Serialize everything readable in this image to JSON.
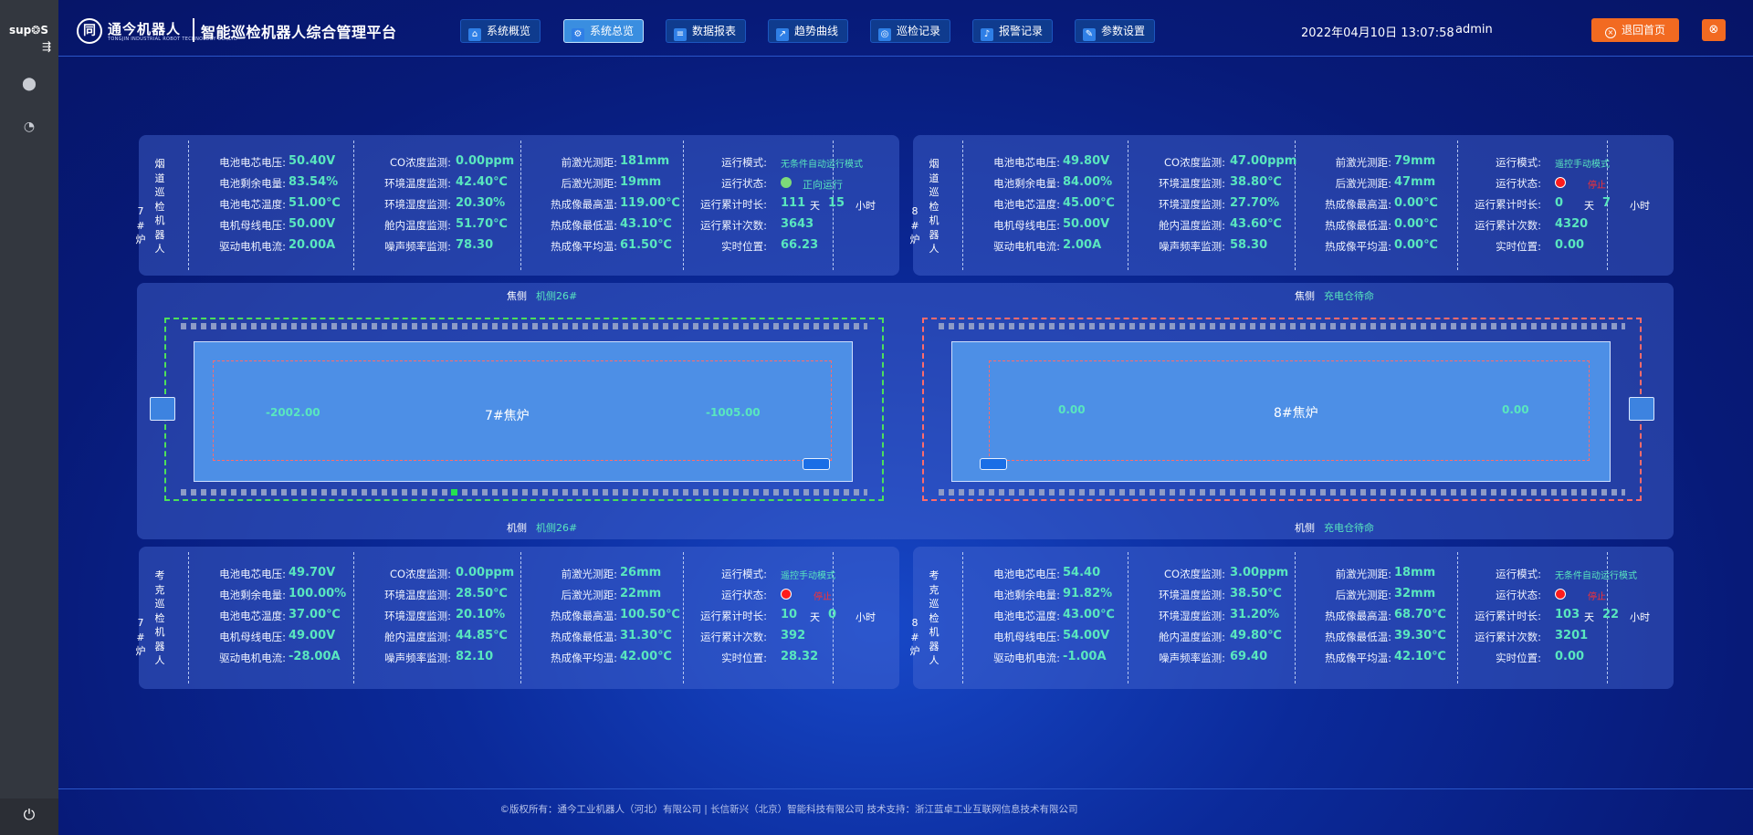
{
  "sidebar": {
    "brand": "sup❂S",
    "collapse_glyph": "⇶",
    "items": [
      {
        "icon": "app-icon",
        "glyph": "⬤"
      },
      {
        "icon": "chart-icon",
        "glyph": "◔"
      }
    ],
    "power_glyph": "⏻"
  },
  "header": {
    "logo_glyph": "同",
    "company": "通今机器人",
    "company_en": "TONGJIN INDUSTRIAL ROBOT TECHNOLOGY CO.,LTD",
    "title": "智能巡检机器人综合管理平台",
    "nav": [
      {
        "label": "系统概览",
        "icon": "bank-icon",
        "glyph": "⌂"
      },
      {
        "label": "系统总览",
        "icon": "gear-icon",
        "glyph": "⚙"
      },
      {
        "label": "数据报表",
        "icon": "list-icon",
        "glyph": "≡"
      },
      {
        "label": "趋势曲线",
        "icon": "trend-icon",
        "glyph": "↗"
      },
      {
        "label": "巡检记录",
        "icon": "inspect-icon",
        "glyph": "◎"
      },
      {
        "label": "报警记录",
        "icon": "alarm-icon",
        "glyph": "♪"
      },
      {
        "label": "参数设置",
        "icon": "wrench-icon",
        "glyph": "✎"
      }
    ],
    "active_nav": "系统总览",
    "datetime": "2022年04月10日 13:07:58",
    "user": "admin",
    "return_label": "退回首页",
    "close_glyph": "⊗"
  },
  "robots": [
    {
      "name": "烟道巡检机器人",
      "furnace": "7#炉",
      "col1": [
        [
          "电池电芯电压:",
          "50.40V"
        ],
        [
          "电池剩余电量:",
          "83.54%"
        ],
        [
          "电池电芯温度:",
          "51.00℃"
        ],
        [
          "电机母线电压:",
          "50.00V"
        ],
        [
          "驱动电机电流:",
          "20.00A"
        ]
      ],
      "col2": [
        [
          "CO浓度监测:",
          "0.00ppm"
        ],
        [
          "环境温度监测:",
          "42.40℃"
        ],
        [
          "环境湿度监测:",
          "20.30%"
        ],
        [
          "舱内温度监测:",
          "51.70℃"
        ],
        [
          "噪声频率监测:",
          "78.30"
        ]
      ],
      "col3": [
        [
          "前激光测距:",
          "181mm"
        ],
        [
          "后激光测距:",
          "19mm"
        ],
        [
          "热成像最高温:",
          "119.00℃"
        ],
        [
          "热成像最低温:",
          "43.10℃"
        ],
        [
          "热成像平均温:",
          "61.50℃"
        ]
      ],
      "mode_label": "运行模式:",
      "mode": "无条件自动运行模式",
      "state_label": "运行状态:",
      "state": "正向运行",
      "state_color": "green",
      "runtime_label": "运行累计时长:",
      "days": "111",
      "day_unit": "天",
      "hours": "15",
      "hour_unit": "小时",
      "count_label": "运行累计次数:",
      "count": "3643",
      "pos_label": "实时位置:",
      "position": "66.23"
    },
    {
      "name": "烟道巡检机器人",
      "furnace": "8#炉",
      "col1": [
        [
          "电池电芯电压:",
          "49.80V"
        ],
        [
          "电池剩余电量:",
          "84.00%"
        ],
        [
          "电池电芯温度:",
          "45.00℃"
        ],
        [
          "电机母线电压:",
          "50.00V"
        ],
        [
          "驱动电机电流:",
          "2.00A"
        ]
      ],
      "col2": [
        [
          "CO浓度监测:",
          "47.00ppm"
        ],
        [
          "环境温度监测:",
          "38.80℃"
        ],
        [
          "环境湿度监测:",
          "27.70%"
        ],
        [
          "舱内温度监测:",
          "43.60℃"
        ],
        [
          "噪声频率监测:",
          "58.30"
        ]
      ],
      "col3": [
        [
          "前激光测距:",
          "79mm"
        ],
        [
          "后激光测距:",
          "47mm"
        ],
        [
          "热成像最高温:",
          "0.00℃"
        ],
        [
          "热成像最低温:",
          "0.00℃"
        ],
        [
          "热成像平均温:",
          "0.00℃"
        ]
      ],
      "mode_label": "运行模式:",
      "mode": "遥控手动模式",
      "state_label": "运行状态:",
      "state": "停止",
      "state_color": "red",
      "runtime_label": "运行累计时长:",
      "days": "0",
      "day_unit": "天",
      "hours": "7",
      "hour_unit": "小时",
      "count_label": "运行累计次数:",
      "count": "4320",
      "pos_label": "实时位置:",
      "position": "0.00"
    },
    {
      "name": "考克巡检机器人",
      "furnace": "7#炉",
      "col1": [
        [
          "电池电芯电压:",
          "49.70V"
        ],
        [
          "电池剩余电量:",
          "100.00%"
        ],
        [
          "电池电芯温度:",
          "37.00℃"
        ],
        [
          "电机母线电压:",
          "49.00V"
        ],
        [
          "驱动电机电流:",
          "-28.00A"
        ]
      ],
      "col2": [
        [
          "CO浓度监测:",
          "0.00ppm"
        ],
        [
          "环境温度监测:",
          "28.50℃"
        ],
        [
          "环境湿度监测:",
          "20.10%"
        ],
        [
          "舱内温度监测:",
          "44.85℃"
        ],
        [
          "噪声频率监测:",
          "82.10"
        ]
      ],
      "col3": [
        [
          "前激光测距:",
          "26mm"
        ],
        [
          "后激光测距:",
          "22mm"
        ],
        [
          "热成像最高温:",
          "100.50℃"
        ],
        [
          "热成像最低温:",
          "31.30℃"
        ],
        [
          "热成像平均温:",
          "42.00℃"
        ]
      ],
      "mode_label": "运行模式:",
      "mode": "遥控手动模式",
      "state_label": "运行状态:",
      "state": "停止",
      "state_color": "red",
      "runtime_label": "运行累计时长:",
      "days": "10",
      "day_unit": "天",
      "hours": "0",
      "hour_unit": "小时",
      "count_label": "运行累计次数:",
      "count": "392",
      "pos_label": "实时位置:",
      "position": "28.32"
    },
    {
      "name": "考克巡检机器人",
      "furnace": "8#炉",
      "col1": [
        [
          "电池电芯电压:",
          "54.40"
        ],
        [
          "电池剩余电量:",
          "91.82%"
        ],
        [
          "电池电芯温度:",
          "43.00℃"
        ],
        [
          "电机母线电压:",
          "54.00V"
        ],
        [
          "驱动电机电流:",
          "-1.00A"
        ]
      ],
      "col2": [
        [
          "CO浓度监测:",
          "3.00ppm"
        ],
        [
          "环境温度监测:",
          "38.50℃"
        ],
        [
          "环境湿度监测:",
          "31.20%"
        ],
        [
          "舱内温度监测:",
          "49.80℃"
        ],
        [
          "噪声频率监测:",
          "69.40"
        ]
      ],
      "col3": [
        [
          "前激光测距:",
          "18mm"
        ],
        [
          "后激光测距:",
          "32mm"
        ],
        [
          "热成像最高温:",
          "68.70℃"
        ],
        [
          "热成像最低温:",
          "39.30℃"
        ],
        [
          "热成像平均温:",
          "42.10℃"
        ]
      ],
      "mode_label": "运行模式:",
      "mode": "无条件自动运行模式",
      "state_label": "运行状态:",
      "state": "停止",
      "state_color": "red",
      "runtime_label": "运行累计时长:",
      "days": "103",
      "day_unit": "天",
      "hours": "22",
      "hour_unit": "小时",
      "count_label": "运行累计次数:",
      "count": "3201",
      "pos_label": "实时位置:",
      "position": "0.00"
    }
  ],
  "tracks": [
    {
      "top_label": "焦侧",
      "top_status": "机侧26#",
      "bottom_label": "机侧",
      "bottom_status": "机侧26#",
      "name": "7#焦炉",
      "left_value": "-2002.00",
      "right_value": "-1005.00",
      "border_color": "#4de05a"
    },
    {
      "top_label": "焦侧",
      "top_status": "充电仓待命",
      "bottom_label": "机侧",
      "bottom_status": "充电仓待命",
      "name": "8#焦炉",
      "left_value": "0.00",
      "right_value": "0.00",
      "border_color": "#ff6b6b"
    }
  ],
  "footer": {
    "text": "©版权所有：通今工业机器人（河北）有限公司 | 长信新兴（北京）智能科技有限公司      技术支持：浙江蓝卓工业互联网信息技术有限公司"
  }
}
